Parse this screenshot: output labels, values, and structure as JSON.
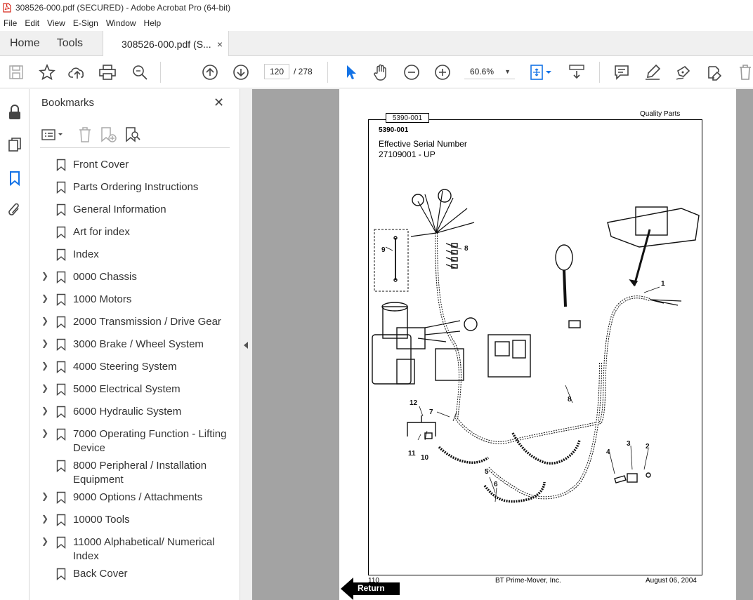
{
  "window": {
    "title": "308526-000.pdf (SECURED) - Adobe Acrobat Pro (64-bit)"
  },
  "menu": [
    "File",
    "Edit",
    "View",
    "E-Sign",
    "Window",
    "Help"
  ],
  "tabs": {
    "home": "Home",
    "tools": "Tools",
    "document": "308526-000.pdf (S...",
    "close": "×"
  },
  "toolbar": {
    "page_current": "120",
    "page_total": "/  278",
    "zoom": "60.6%"
  },
  "panel": {
    "title": "Bookmarks",
    "close": "✕",
    "bookmarks": [
      {
        "label": "Front Cover",
        "expandable": false
      },
      {
        "label": "Parts Ordering Instructions",
        "expandable": false
      },
      {
        "label": "General Information",
        "expandable": false
      },
      {
        "label": "Art for index",
        "expandable": false
      },
      {
        "label": "Index",
        "expandable": false
      },
      {
        "label": "0000 Chassis",
        "expandable": true
      },
      {
        "label": "1000 Motors",
        "expandable": true
      },
      {
        "label": "2000 Transmission / Drive Gear",
        "expandable": true
      },
      {
        "label": "3000 Brake / Wheel System",
        "expandable": true
      },
      {
        "label": "4000 Steering System",
        "expandable": true
      },
      {
        "label": "5000 Electrical System",
        "expandable": true
      },
      {
        "label": "6000 Hydraulic System",
        "expandable": true
      },
      {
        "label": "7000 Operating Function - Lifting Device",
        "expandable": true
      },
      {
        "label": "8000 Peripheral / Installation Equipment",
        "expandable": false
      },
      {
        "label": "9000 Options / Attachments",
        "expandable": true
      },
      {
        "label": "10000 Tools",
        "expandable": true
      },
      {
        "label": "11000 Alphabetical/ Numerical Index",
        "expandable": true
      },
      {
        "label": "Back Cover",
        "expandable": false
      }
    ]
  },
  "document": {
    "part_tag": "5390-001",
    "part_number": "5390-001",
    "header_right": "Quality Parts",
    "effective_label": "Effective Serial Number",
    "serial_range": "27109001 - UP",
    "footer_page": "110",
    "footer_center": "BT Prime-Mover, Inc.",
    "footer_date": "August 06, 2004",
    "return_label": "Return",
    "callouts": [
      "1",
      "2",
      "3",
      "4",
      "5",
      "6",
      "7",
      "8",
      "8",
      "9",
      "10",
      "11",
      "12"
    ]
  }
}
